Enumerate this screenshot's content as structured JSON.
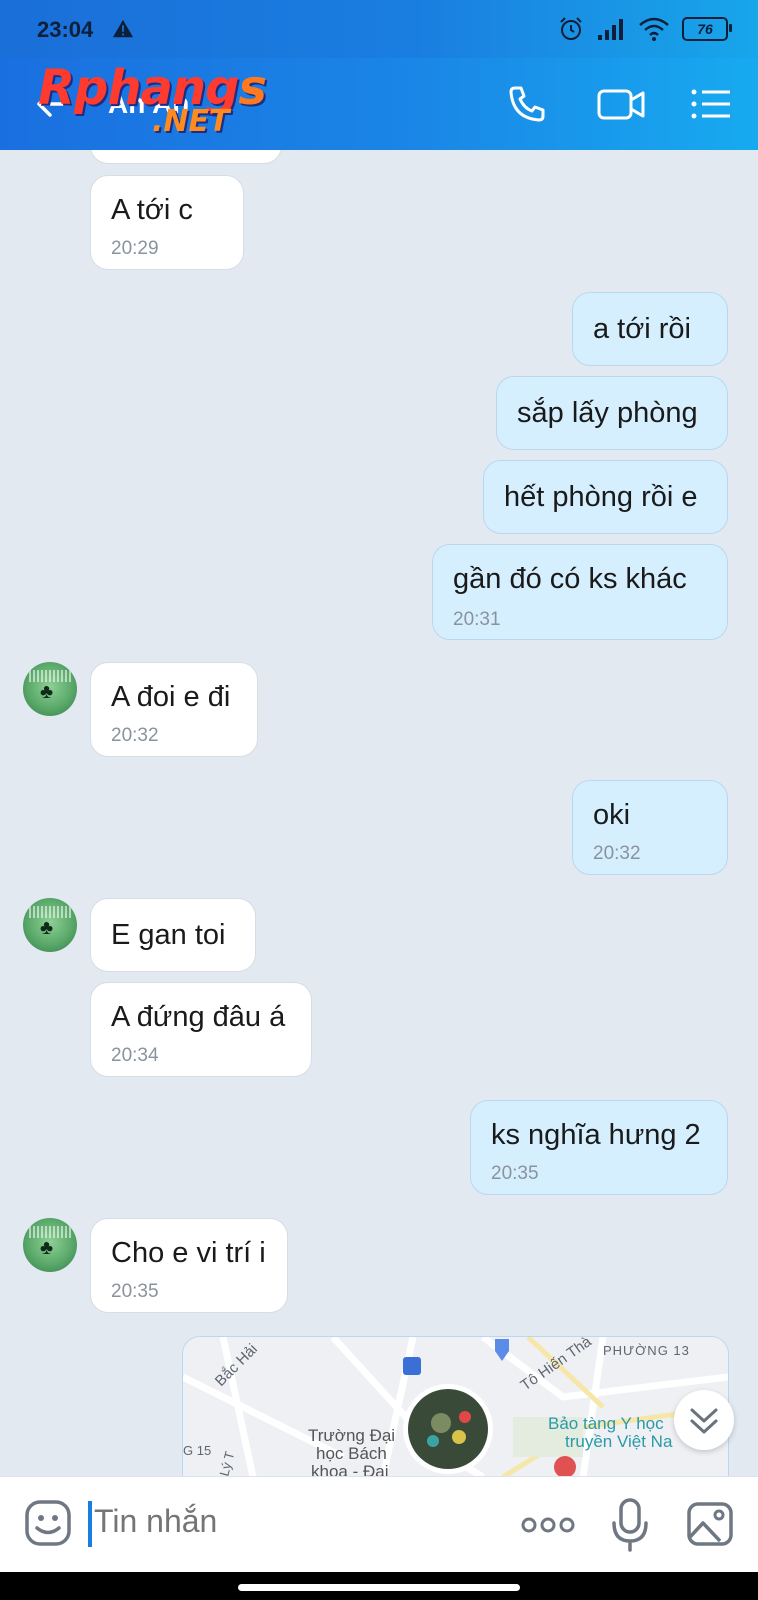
{
  "status_bar": {
    "time": "23:04",
    "battery": "76"
  },
  "header": {
    "contact_name": "An An",
    "logo_main": "Rphang",
    "logo_s": "s",
    "logo_net": ".NET",
    "icons": [
      "back-arrow-icon",
      "phone-icon",
      "video-call-icon",
      "menu-list-icon"
    ]
  },
  "messages": [
    {
      "dir": "in",
      "text": "A tới c",
      "time": "20:29"
    },
    {
      "dir": "out",
      "text": "a tới rồi",
      "time": ""
    },
    {
      "dir": "out",
      "text": "sắp lấy phòng",
      "time": ""
    },
    {
      "dir": "out",
      "text": "hết phòng rồi e",
      "time": ""
    },
    {
      "dir": "out",
      "text": "gần đó có ks khác",
      "time": "20:31"
    },
    {
      "dir": "in",
      "text": "A đoi e đi",
      "time": "20:32"
    },
    {
      "dir": "out",
      "text": "oki",
      "time": "20:32"
    },
    {
      "dir": "in",
      "text": "E gan toi",
      "time": ""
    },
    {
      "dir": "in",
      "text": "A đứng đâu á",
      "time": "20:34"
    },
    {
      "dir": "out",
      "text": "ks nghĩa hưng 2",
      "time": "20:35"
    },
    {
      "dir": "in",
      "text": "Cho e vi trí i",
      "time": "20:35"
    }
  ],
  "map_card": {
    "labels": [
      "Bắc Hải",
      "PHƯỜNG 13",
      "Tô Hiến Thà",
      "Trường Đại",
      "học Bách",
      "khoa - Đại",
      "Bảo tàng Y học",
      "truyền Việt Na",
      "G 15",
      "Lý T"
    ]
  },
  "composer": {
    "placeholder": "Tin nhắn"
  },
  "colors": {
    "header_start": "#1a6fe0",
    "header_end": "#17aaf0",
    "out_bubble": "#d5efff",
    "in_bubble": "#ffffff",
    "chat_bg": "#e2e9f1"
  }
}
